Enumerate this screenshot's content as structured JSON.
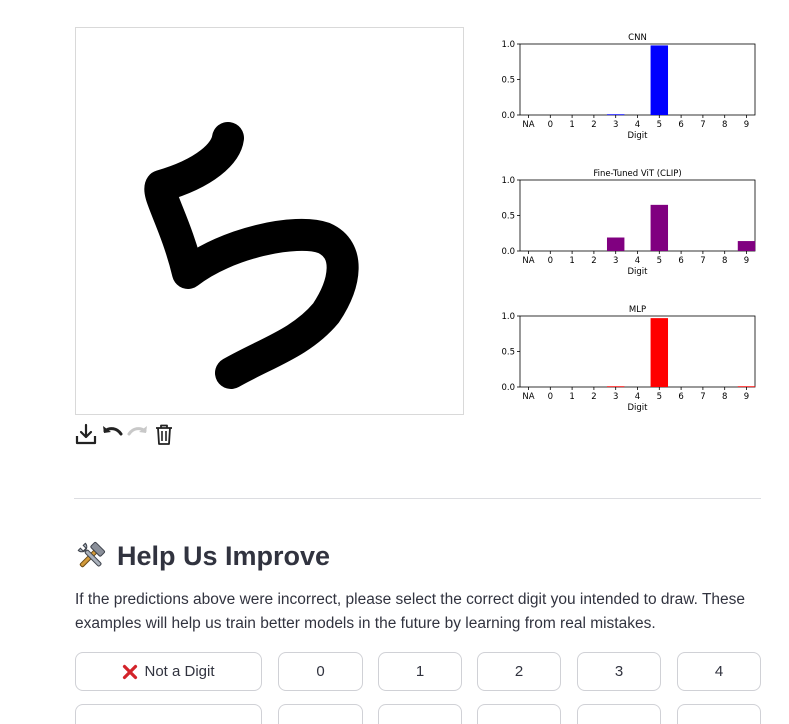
{
  "canvas": {
    "tools": [
      {
        "name": "download-icon"
      },
      {
        "name": "undo-icon"
      },
      {
        "name": "redo-icon"
      },
      {
        "name": "trash-icon"
      }
    ]
  },
  "chart_data": [
    {
      "type": "bar",
      "title": "CNN",
      "xlabel": "Digit",
      "ylabel": "",
      "categories": [
        "NA",
        "0",
        "1",
        "2",
        "3",
        "4",
        "5",
        "6",
        "7",
        "8",
        "9"
      ],
      "values": [
        0,
        0,
        0,
        0,
        0.01,
        0,
        0.98,
        0,
        0,
        0,
        0
      ],
      "ylim": [
        0,
        1.0
      ],
      "yticks": [
        "0.0",
        "0.5",
        "1.0"
      ],
      "color": "#0000ff"
    },
    {
      "type": "bar",
      "title": "Fine-Tuned ViT (CLIP)",
      "xlabel": "Digit",
      "ylabel": "",
      "categories": [
        "NA",
        "0",
        "1",
        "2",
        "3",
        "4",
        "5",
        "6",
        "7",
        "8",
        "9"
      ],
      "values": [
        0,
        0,
        0,
        0,
        0.19,
        0,
        0.65,
        0,
        0,
        0,
        0.14
      ],
      "ylim": [
        0,
        1.0
      ],
      "yticks": [
        "0.0",
        "0.5",
        "1.0"
      ],
      "color": "#800080"
    },
    {
      "type": "bar",
      "title": "MLP",
      "xlabel": "Digit",
      "ylabel": "",
      "categories": [
        "NA",
        "0",
        "1",
        "2",
        "3",
        "4",
        "5",
        "6",
        "7",
        "8",
        "9"
      ],
      "values": [
        0,
        0,
        0,
        0,
        0.01,
        0,
        0.97,
        0,
        0,
        0,
        0.01
      ],
      "ylim": [
        0,
        1.0
      ],
      "yticks": [
        "0.0",
        "0.5",
        "1.0"
      ],
      "color": "#ff0000"
    }
  ],
  "feedback": {
    "icon": "hammer-and-wrench-icon",
    "title": "Help Us Improve",
    "description": "If the predictions above were incorrect, please select the correct digit you intended to draw. These examples will help us train better models in the future by learning from real mistakes.",
    "buttons": [
      {
        "label": "Not a Digit",
        "icon": "cross-mark-icon"
      },
      {
        "label": "0"
      },
      {
        "label": "1"
      },
      {
        "label": "2"
      },
      {
        "label": "3"
      },
      {
        "label": "4"
      }
    ]
  }
}
